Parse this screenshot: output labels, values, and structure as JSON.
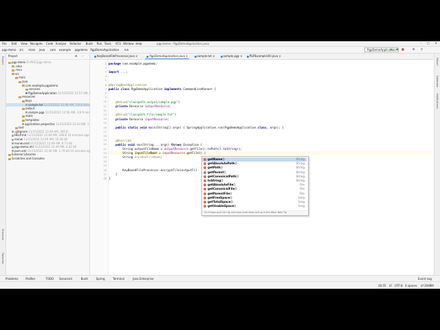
{
  "window": {
    "title": "pgp-demo - PgpDemoApplication.java"
  },
  "menu": [
    "File",
    "Edit",
    "View",
    "Navigate",
    "Code",
    "Analyze",
    "Refactor",
    "Build",
    "Run",
    "Tools",
    "VCS",
    "Window",
    "Help"
  ],
  "breadcrumbs": [
    "pgp-demo",
    "src",
    "main",
    "java",
    "com",
    "example",
    "pgpdemo",
    "PgpDemoApplication",
    "run"
  ],
  "run_config": "PgpDemoApplication",
  "project_panel": {
    "title": "Project",
    "tree": [
      {
        "label": "pgp-demo",
        "meta": "D:\\POC\\pgp-demo",
        "type": "folder",
        "indent": 0
      },
      {
        "label": ".idea",
        "type": "folder",
        "indent": 1
      },
      {
        "label": ".mvn",
        "type": "folder",
        "indent": 1
      },
      {
        "label": "src",
        "type": "folder",
        "indent": 1
      },
      {
        "label": "main",
        "type": "folder",
        "indent": 2
      },
      {
        "label": "java",
        "type": "folder",
        "indent": 3
      },
      {
        "label": "com.example.pgpdemo",
        "type": "folder",
        "indent": 4
      },
      {
        "label": "services",
        "type": "folder",
        "indent": 5
      },
      {
        "label": "PgpDemoApplication",
        "meta": "11/15/2022 12:57 AM, 888 B",
        "type": "java",
        "indent": 5
      },
      {
        "label": "resources",
        "type": "folder",
        "indent": 3
      },
      {
        "label": "Keys",
        "type": "folder",
        "indent": 4
      },
      {
        "label": "sample.txt",
        "meta": "11/15/2022 12:48 AM, 3 B 6 minutes ago",
        "type": "file",
        "indent": 5,
        "selected": true
      },
      {
        "label": "output",
        "type": "folder",
        "indent": 4
      },
      {
        "label": "sample.pgp",
        "meta": "11/15/2022 12:56 AM, 3 B 9 minutes ago",
        "type": "file",
        "indent": 5
      },
      {
        "label": "static",
        "type": "folder",
        "indent": 4
      },
      {
        "label": "templates",
        "type": "folder",
        "indent": 4
      },
      {
        "label": "application.properties",
        "meta": "11/15/2022 12:43 AM, 1 B 44 minutes",
        "type": "file",
        "indent": 4
      },
      {
        "label": "test",
        "type": "folder",
        "indent": 2
      },
      {
        "label": ".gitignore",
        "meta": "11/15/2022 12:49 AM, 395 B",
        "type": "file",
        "indent": 1
      },
      {
        "label": "HELP.md",
        "meta": "11/15/2022 12:49 AM, 208 B 10 minutes ago",
        "type": "file",
        "indent": 1
      },
      {
        "label": "mvnw",
        "meta": "11/15/2022 12:49 AM, 10.28 kB",
        "type": "file",
        "indent": 1
      },
      {
        "label": "mvnw.cmd",
        "meta": "11/15/2022 12:49 AM, 6.73 kB",
        "type": "file",
        "indent": 1
      },
      {
        "label": "pgp-demo.iml",
        "meta": "11/15/2022 12:49 AM, 6.42 kB",
        "type": "file",
        "indent": 1
      },
      {
        "label": "pom.xml",
        "meta": "11/15/2022 12:44 AM, 1.79 kB 33 minutes ago",
        "type": "file",
        "indent": 1
      },
      {
        "label": "External Libraries",
        "type": "folder",
        "indent": 0
      },
      {
        "label": "Scratches and Consoles",
        "type": "folder",
        "indent": 0
      }
    ]
  },
  "editor_tabs": [
    {
      "label": "KeyBasedFileProcessor.java",
      "active": false
    },
    {
      "label": "PgpDemoApplication.java",
      "active": true
    },
    {
      "label": "sample.txt",
      "active": false
    },
    {
      "label": "sample.pgp",
      "active": false
    },
    {
      "label": "PGPExampleUtil.java",
      "active": false
    }
  ],
  "code_lines": [
    {
      "n": 1,
      "html": "<span class=\"kw\">package</span> com.example.pgpdemo;"
    },
    {
      "n": 2,
      "html": ""
    },
    {
      "n": 3,
      "html": "<span class=\"kw\">import</span> ...;"
    },
    {
      "n": 4,
      "html": ""
    },
    {
      "n": 5,
      "html": ""
    },
    {
      "n": 6,
      "html": "<span class=\"ann\">@SpringBootApplication</span>"
    },
    {
      "n": 7,
      "html": "<span class=\"kw\">public class</span> PgpDemoApplication <span class=\"kw\">implements</span> CommandLineRunner {"
    },
    {
      "n": 8,
      "html": ""
    },
    {
      "n": 9,
      "html": ""
    },
    {
      "n": 10,
      "html": "    <span class=\"ann\">@Value</span>(<span class=\"str\">\"classpath:output/sample.pgp\"</span>)"
    },
    {
      "n": 11,
      "html": "    <span class=\"kw\">private</span> Resource <span class=\"fld\">outputResource</span>;"
    },
    {
      "n": 12,
      "html": ""
    },
    {
      "n": 13,
      "html": "    <span class=\"ann\">@Value</span>(<span class=\"str\">\"classpath:file/sample.txt\"</span>)"
    },
    {
      "n": 14,
      "html": "    <span class=\"kw\">private</span> Resource <span class=\"fld\">inputResource</span>;"
    },
    {
      "n": 15,
      "html": ""
    },
    {
      "n": 16,
      "html": "    <span class=\"kw\">public static void</span> main(String[] args) { SpringApplication.<i>run</i>(PgpDemoApplication.<span class=\"kw\">class</span>, args); }"
    },
    {
      "n": 17,
      "html": ""
    },
    {
      "n": 18,
      "html": ""
    },
    {
      "n": 19,
      "html": "    <span class=\"ann\">@Override</span>"
    },
    {
      "n": 20,
      "html": "    <span class=\"kw\">public void</span> run(String... args) <span class=\"kw\">throws</span> Exception {"
    },
    {
      "n": 21,
      "html": "        String outputFileName = <span class=\"fld\">outputResource</span>.getFile().toPath().toString();"
    },
    {
      "n": 22,
      "html": "        String <span class=\"hl\">inputFileName</span> = <span class=\"fld\">inputResource</span>.getFile().|",
      "hl": true
    },
    {
      "n": 23,
      "html": "        String <span class=\"cmt\">encodedFileName</span>;"
    },
    {
      "n": 24,
      "html": ""
    },
    {
      "n": 25,
      "html": ""
    },
    {
      "n": 26,
      "html": "        KeyBasedFileProcessor.<i>encryptFile</i>(outputFil"
    },
    {
      "n": 27,
      "html": "    }"
    },
    {
      "n": 28,
      "html": "}"
    }
  ],
  "completion": {
    "items": [
      {
        "name": "getName",
        "sig": "()",
        "type": "String",
        "selected": true
      },
      {
        "name": "getAbsolutePath",
        "sig": "()",
        "type": "String"
      },
      {
        "name": "getPath",
        "sig": "()",
        "type": "String"
      },
      {
        "name": "getParent",
        "sig": "()",
        "type": "String"
      },
      {
        "name": "getCanonicalPath",
        "sig": "()",
        "type": "String"
      },
      {
        "name": "toString",
        "sig": "()",
        "type": "String"
      },
      {
        "name": "getAbsoluteFile",
        "sig": "()",
        "type": "File"
      },
      {
        "name": "getCanonicalFile",
        "sig": "()",
        "type": "File"
      },
      {
        "name": "getParentFile",
        "sig": "()",
        "type": "File"
      },
      {
        "name": "getFreeSpace",
        "sig": "()",
        "type": "long"
      },
      {
        "name": "getTotalSpace",
        "sig": "()",
        "type": "long"
      },
      {
        "name": "getUsableSpace",
        "sig": "()",
        "type": "long"
      }
    ],
    "hint": "Ctrl+Down and Ctrl+Up will move caret down and up in the editor  Next Tip"
  },
  "right_tabs": [
    "Maven",
    "Database",
    "Notifications"
  ],
  "left_tabs": [
    "Project",
    "Structure",
    "Favorites"
  ],
  "bottom_tabs": [
    "Problems",
    "Profiler",
    "TODO",
    "SonarLint",
    "Build",
    "Spring",
    "Terminal",
    "Java Enterprise"
  ],
  "status": {
    "position": "26:55",
    "line_sep": "LF",
    "encoding": "UTF-8",
    "indent": "4 spaces",
    "memory": "of 2048M",
    "event_log": "Event Log"
  }
}
